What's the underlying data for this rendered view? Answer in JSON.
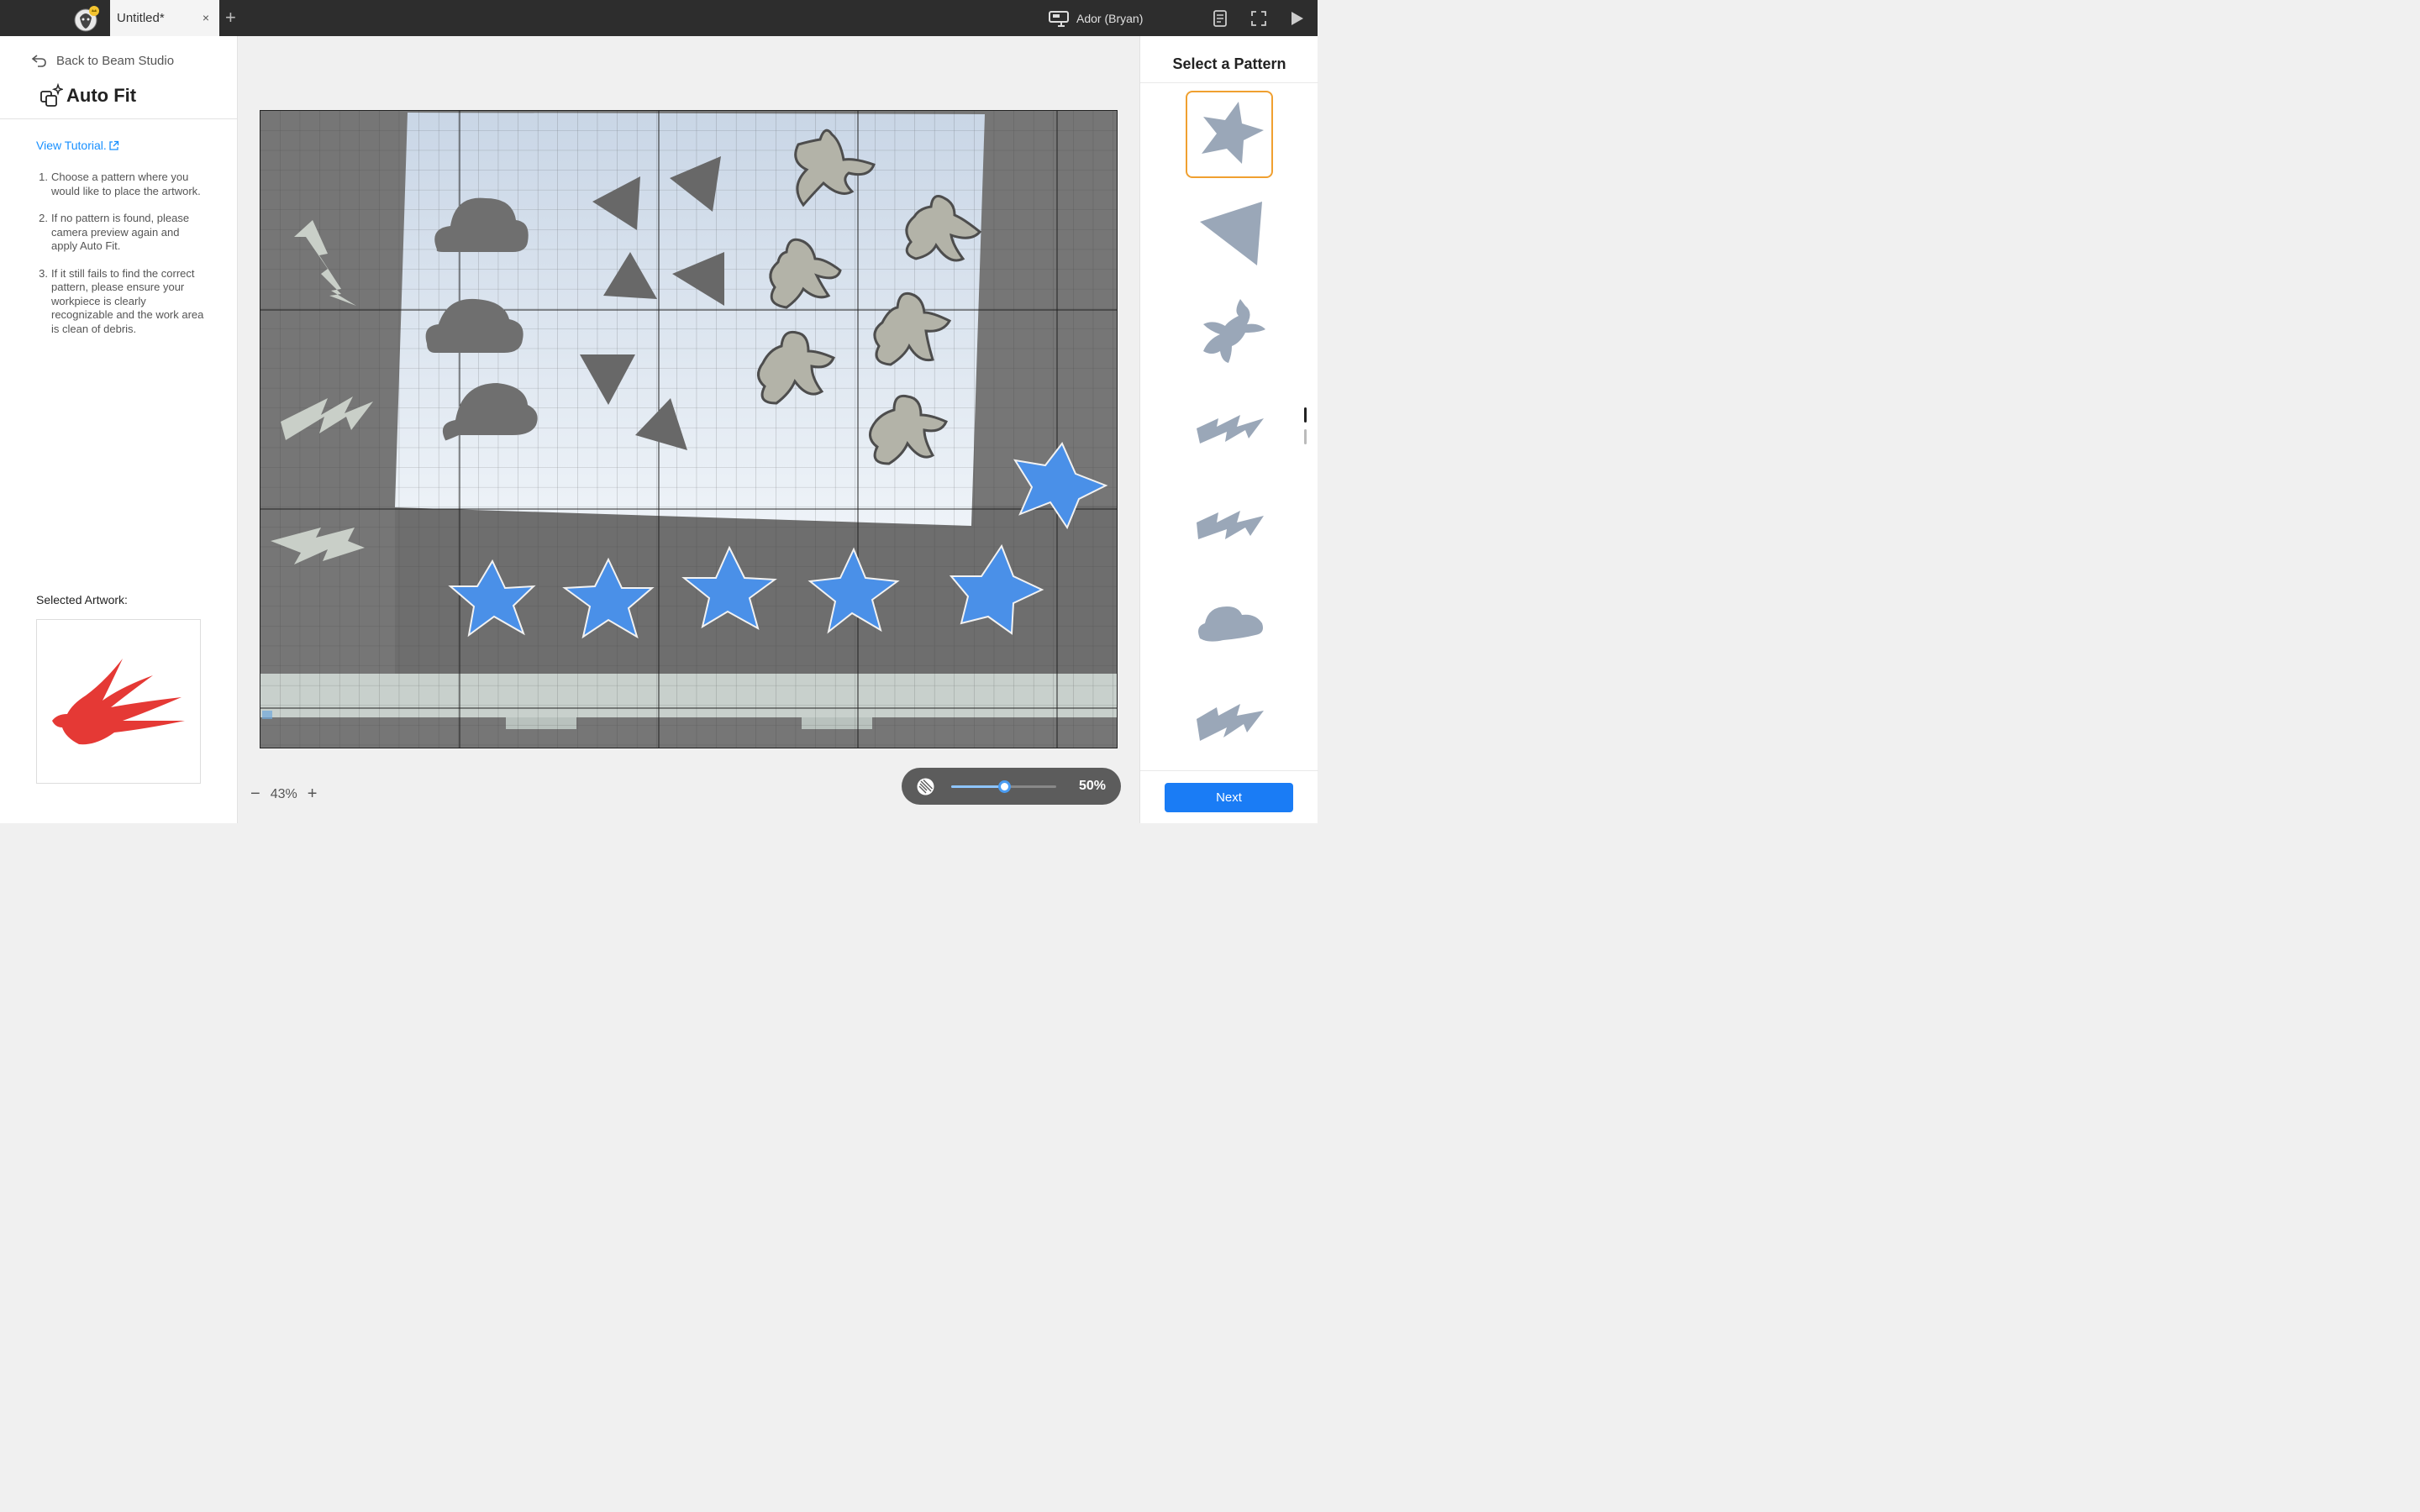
{
  "titlebar": {
    "tab_title": "Untitled*",
    "tab_close": "×",
    "new_tab": "+",
    "device_name": "Ador (Bryan)"
  },
  "left_panel": {
    "back_label": "Back to Beam Studio",
    "title": "Auto Fit",
    "tutorial_label": "View Tutorial.",
    "steps": [
      {
        "num": "1.",
        "text": "Choose a pattern where you would like to place the artwork."
      },
      {
        "num": "2.",
        "text": "If no pattern is found, please camera preview again and apply Auto Fit."
      },
      {
        "num": "3.",
        "text": "If it still fails to find the correct pattern, please ensure your workpiece is clearly recognizable and the work area is clean of debris."
      }
    ],
    "artwork_label": "Selected Artwork:"
  },
  "zoom": {
    "minus": "−",
    "value": "43%",
    "plus": "+"
  },
  "opacity": {
    "value_label": "50%",
    "fraction": 0.5
  },
  "right_panel": {
    "title": "Select a Pattern",
    "patterns": [
      "star",
      "triangle",
      "gingerbread-man",
      "lightning-bolt",
      "lightning-bolt",
      "cloud",
      "lightning-bolt"
    ],
    "selected_index": 0,
    "next_label": "Next"
  },
  "colors": {
    "accent_blue": "#1a7cf5",
    "selected_border": "#f0a030",
    "highlight_star": "#4a90e8",
    "artwork_red": "#e53935",
    "pattern_gray": "#9aa7b8"
  }
}
